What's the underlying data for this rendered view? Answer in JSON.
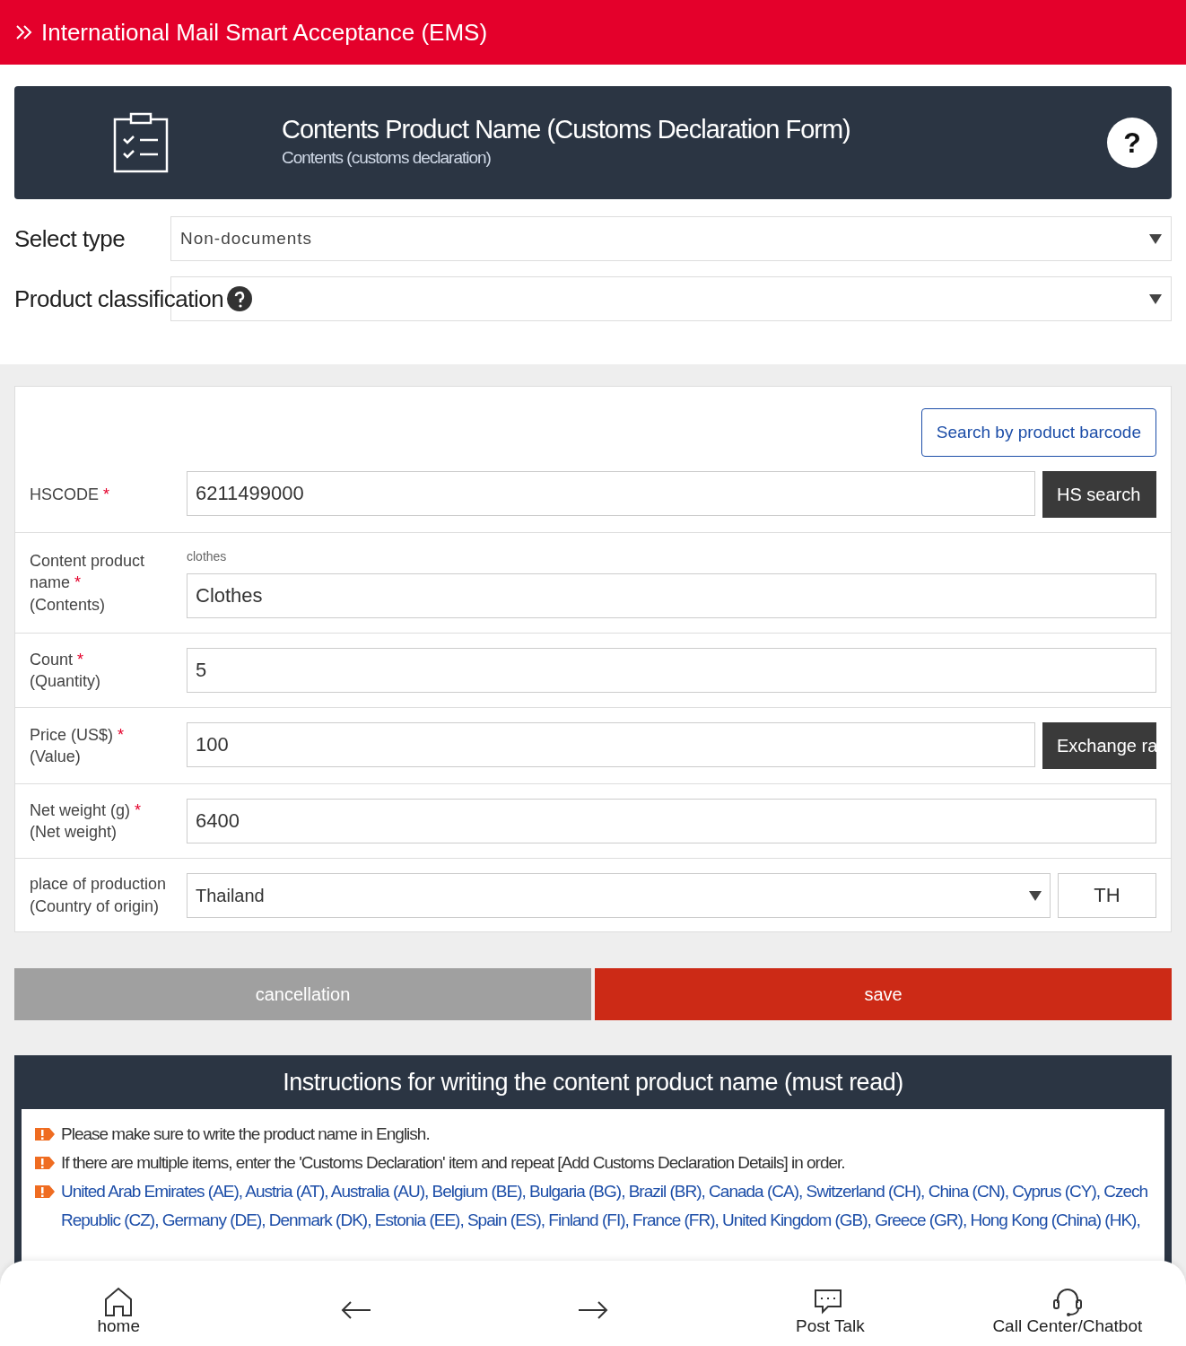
{
  "header": {
    "title": "International Mail Smart Acceptance (EMS)"
  },
  "banner": {
    "title": "Contents Product Name (Customs Declaration Form)",
    "subtitle": "Contents (customs declaration)",
    "help_button": "?"
  },
  "required_mark": "*",
  "selects": [
    {
      "label": "Select type",
      "value": "Non-documents",
      "help": false
    },
    {
      "label": "Product classification",
      "help": true
    }
  ],
  "barcode_button": "Search by product barcode",
  "fields": [
    {
      "label": "HSCODE",
      "required": true,
      "value": "6211499000",
      "kind": "button",
      "button": "HS search"
    },
    {
      "label": "Content product name",
      "sub": "(Contents)",
      "required": true,
      "hint": "clothes",
      "value": "Clothes",
      "kind": "text"
    },
    {
      "label": "Count",
      "sub": "(Quantity)",
      "required": true,
      "value": "5",
      "kind": "text"
    },
    {
      "label": "Price (US$)",
      "sub": "(Value)",
      "required": true,
      "value": "100",
      "kind": "button",
      "button": "Exchange ra"
    },
    {
      "label": "Net weight (g)",
      "sub": "(Net weight)",
      "required": true,
      "value": "6400",
      "kind": "text"
    },
    {
      "label": "place of production",
      "sub": "(Country of origin)",
      "required": false,
      "value": "Thailand",
      "kind": "country",
      "code": "TH"
    }
  ],
  "actions": [
    {
      "label": "cancellation",
      "kind": "cancel"
    },
    {
      "label": "save",
      "kind": "save"
    }
  ],
  "instructions": {
    "title": "Instructions for writing the content product name (must read)",
    "items": [
      {
        "text": "Please make sure to write the product name in English.",
        "kind": "plain"
      },
      {
        "text": "If there are multiple items, enter the 'Customs Declaration' item and repeat [Add Customs Declaration Details] in order.",
        "kind": "plain"
      },
      {
        "text": "United Arab Emirates (AE), Austria (AT), Australia (AU), Belgium (BE), Bulgaria (BG), Brazil (BR), Canada (CA), Switzerland (CH), China (CN), Cyprus (CY), Czech Republic (CZ), Germany (DE), Denmark (DK), Estonia (EE), Spain (ES), Finland (FI), France (FR), United Kingdom (GB), Greece (GR), Hong Kong (China) (HK),",
        "kind": "countries"
      }
    ]
  },
  "nav": [
    {
      "label": "home",
      "kind": "labeled"
    },
    {
      "kind": "icon"
    },
    {
      "kind": "icon"
    },
    {
      "label": "Post Talk",
      "kind": "labeled"
    },
    {
      "label": "Call Center/Chatbot",
      "kind": "labeled"
    }
  ]
}
